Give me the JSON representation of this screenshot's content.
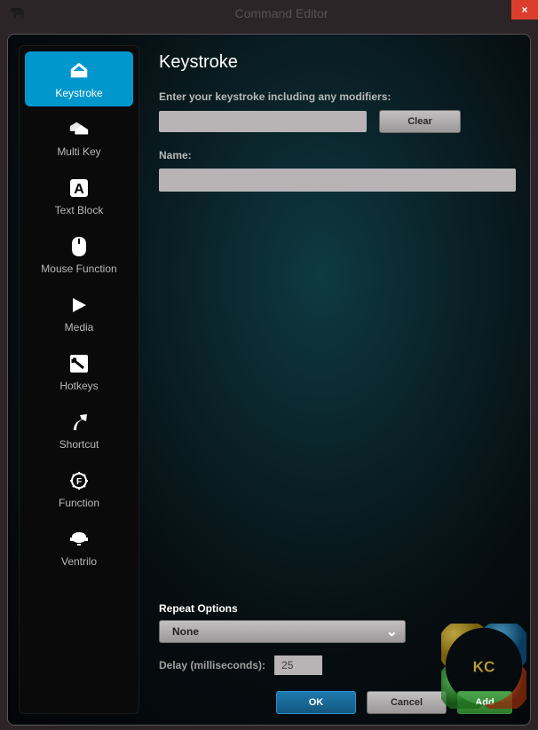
{
  "window": {
    "title": "Command Editor",
    "close_symbol": "×"
  },
  "sidebar": {
    "items": [
      {
        "label": "Keystroke",
        "active": true
      },
      {
        "label": "Multi Key",
        "active": false
      },
      {
        "label": "Text Block",
        "active": false
      },
      {
        "label": "Mouse Function",
        "active": false
      },
      {
        "label": "Media",
        "active": false
      },
      {
        "label": "Hotkeys",
        "active": false
      },
      {
        "label": "Shortcut",
        "active": false
      },
      {
        "label": "Function",
        "active": false
      },
      {
        "label": "Ventrilo",
        "active": false
      }
    ]
  },
  "content": {
    "heading": "Keystroke",
    "keystroke_label": "Enter your keystroke including any modifiers:",
    "keystroke_value": "",
    "clear_label": "Clear",
    "name_label": "Name:",
    "name_value": "",
    "repeat_section_title": "Repeat Options",
    "repeat_selected": "None",
    "delay_label": "Delay (milliseconds):",
    "delay_value": "25"
  },
  "buttons": {
    "ok": "OK",
    "cancel": "Cancel",
    "add": "Add"
  }
}
